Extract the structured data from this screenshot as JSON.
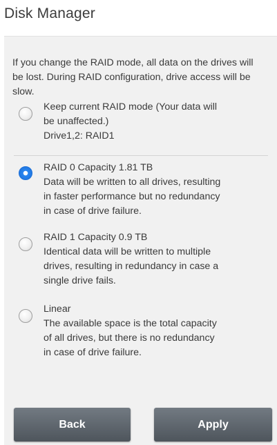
{
  "header": {
    "title": "Disk Manager"
  },
  "warning_text": "If you change the RAID mode, all data on the drives will be lost. During RAID configuration, drive access will be slow.",
  "options": [
    {
      "lines": [
        "Keep current RAID mode (Your data will",
        "be unaffected.)",
        "Drive1,2: RAID1"
      ],
      "selected": false
    },
    {
      "lines": [
        "RAID 0 Capacity 1.81 TB",
        "Data will be written to all drives, resulting",
        "in faster performance but no redundancy",
        "in case of drive failure."
      ],
      "selected": true
    },
    {
      "lines": [
        "RAID 1 Capacity 0.9 TB",
        "Identical data will be written to multiple",
        "drives, resulting in redundancy in case a",
        "single drive fails."
      ],
      "selected": false
    },
    {
      "lines": [
        "Linear",
        "The available space is the total capacity",
        "of all drives, but there is no redundancy",
        "in case of drive failure."
      ],
      "selected": false
    }
  ],
  "buttons": {
    "back_label": "Back",
    "apply_label": "Apply"
  },
  "colors": {
    "accent": "#1c6fd8",
    "button": "#5f666d",
    "panel": "#f1f1f1"
  }
}
